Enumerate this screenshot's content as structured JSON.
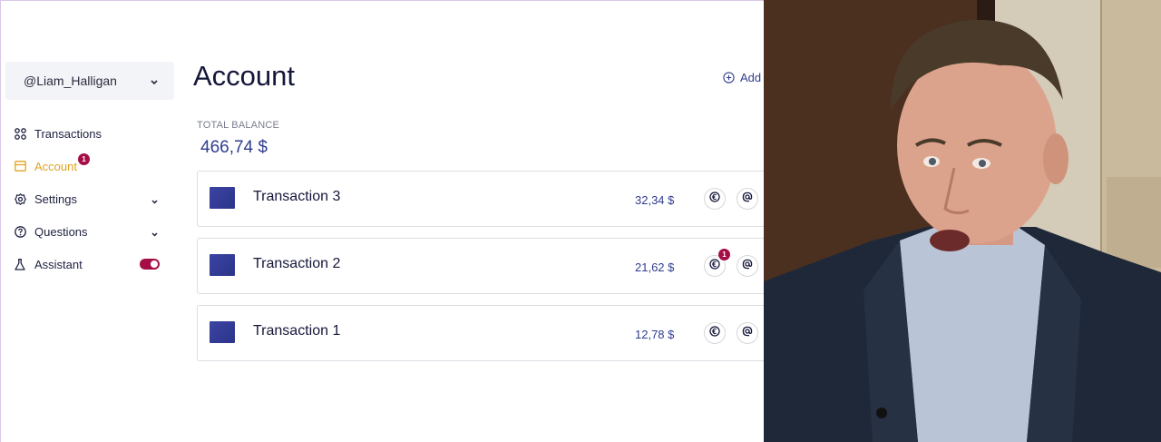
{
  "user": {
    "handle": "@Liam_Halligan"
  },
  "nav": {
    "items": [
      {
        "label": "Transactions",
        "icon": "grid-icon"
      },
      {
        "label": "Account",
        "icon": "wallet-icon",
        "active": true,
        "badge": "1"
      },
      {
        "label": "Settings",
        "icon": "gear-icon",
        "expandable": true
      },
      {
        "label": "Questions",
        "icon": "question-icon",
        "expandable": true
      },
      {
        "label": "Assistant",
        "icon": "flask-icon",
        "toggle_on": true
      }
    ]
  },
  "page": {
    "title": "Account",
    "add_label": "Add",
    "balance_label": "TOTAL BALANCE",
    "balance_value": "466,74 $"
  },
  "transactions": [
    {
      "name": "Transaction 3",
      "amount": "32,34 $"
    },
    {
      "name": "Transaction 2",
      "amount": "21,62 $",
      "badge": "1"
    },
    {
      "name": "Transaction 1",
      "amount": "12,78 $"
    }
  ],
  "colors": {
    "accent": "#2f3d8f",
    "active": "#e0a323",
    "badge": "#a50d46",
    "title": "#15173a"
  }
}
